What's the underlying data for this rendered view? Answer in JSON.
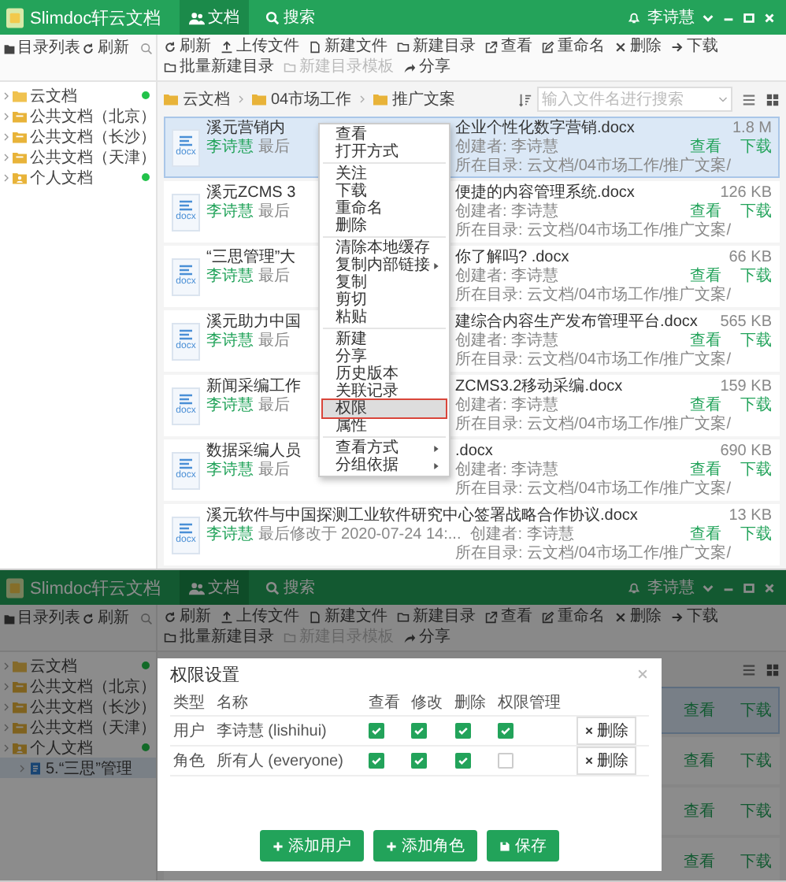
{
  "top": {
    "header": {
      "app_name": "Slimdoc轩云文档",
      "tabs": [
        {
          "label": "文档",
          "selected": true
        },
        {
          "label": "搜索",
          "selected": false
        }
      ],
      "user": "李诗慧"
    },
    "toolbar_left": {
      "title": "目录列表",
      "refresh": "刷新"
    },
    "toolbar": [
      {
        "label": "刷新",
        "disabled": false
      },
      {
        "label": "上传文件",
        "disabled": false
      },
      {
        "label": "新建文件",
        "disabled": false
      },
      {
        "label": "新建目录",
        "disabled": false
      },
      {
        "label": "查看",
        "disabled": false
      },
      {
        "label": "重命名",
        "disabled": false
      },
      {
        "label": "删除",
        "disabled": false
      },
      {
        "label": "下载",
        "disabled": false
      },
      {
        "label": "批量新建目录",
        "disabled": false
      },
      {
        "label": "新建目录模板",
        "disabled": true
      },
      {
        "label": "分享",
        "disabled": false
      }
    ],
    "sidebar": [
      {
        "label": "云文档",
        "kind": "cloud",
        "selected": false
      },
      {
        "label": "公共文档（北京）",
        "kind": "folder",
        "selected": false
      },
      {
        "label": "公共文档（长沙）",
        "kind": "folder",
        "selected": false
      },
      {
        "label": "公共文档（天津）",
        "kind": "folder",
        "selected": false
      },
      {
        "label": "个人文档",
        "kind": "personal",
        "selected": false
      }
    ],
    "breadcrumb": [
      "云文档",
      "04市场工作",
      "推广文案"
    ],
    "search": {
      "placeholder": "输入文件名进行搜索"
    },
    "files": [
      {
        "ext": "docx",
        "name": "溪元营销内",
        "name_tail": "企业个性化数字营销.docx",
        "author": "李诗慧",
        "modified": "最后",
        "creator": "创建者: 李诗慧",
        "folder": "所在目录: 云文档/04市场工作/推广文案/",
        "size": "1.8 M",
        "view": "查看",
        "download": "下载",
        "selected": true
      },
      {
        "ext": "docx",
        "name": "溪元ZCMS 3",
        "name_tail": "便捷的内容管理系统.docx",
        "author": "李诗慧",
        "modified": "最后",
        "creator": "创建者: 李诗慧",
        "folder": "所在目录: 云文档/04市场工作/推广文案/",
        "size": "126 KB",
        "view": "查看",
        "download": "下载",
        "selected": false
      },
      {
        "ext": "docx",
        "name": "“三思管理”大",
        "name_tail": "你了解吗? .docx",
        "author": "李诗慧",
        "modified": "最后",
        "creator": "创建者: 李诗慧",
        "folder": "所在目录: 云文档/04市场工作/推广文案/",
        "size": "66 KB",
        "view": "查看",
        "download": "下载",
        "selected": false
      },
      {
        "ext": "docx",
        "name": "溪元助力中国",
        "name_tail": "建综合内容生产发布管理平台.docx",
        "author": "李诗慧",
        "modified": "最后",
        "creator": "创建者: 李诗慧",
        "folder": "所在目录: 云文档/04市场工作/推广文案/",
        "size": "565 KB",
        "view": "查看",
        "download": "下载",
        "selected": false
      },
      {
        "ext": "docx",
        "name": "新闻采编工作",
        "name_tail": "ZCMS3.2移动采编.docx",
        "author": "李诗慧",
        "modified": "最后",
        "creator": "创建者: 李诗慧",
        "folder": "所在目录: 云文档/04市场工作/推广文案/",
        "size": "159 KB",
        "view": "查看",
        "download": "下载",
        "selected": false
      },
      {
        "ext": "docx",
        "name": "数据采编人员",
        "name_tail": ".docx",
        "author": "李诗慧",
        "modified": "最后",
        "creator": "创建者: 李诗慧",
        "folder": "所在目录: 云文档/04市场工作/推广文案/",
        "size": "690 KB",
        "view": "查看",
        "download": "下载",
        "selected": false
      },
      {
        "ext": "docx",
        "name": "溪元软件与中国探测工业软件研究中心签署战略合作协议.docx",
        "author": "李诗慧",
        "modified": "最后修改于 2020-07-24 14:...",
        "creator": "创建者: 李诗慧",
        "folder": "所在目录: 云文档/04市场工作/推广文案/",
        "size": "13 KB",
        "view": "查看",
        "download": "下载",
        "selected": false
      }
    ],
    "context_menu": [
      {
        "kind": "item",
        "label": "查看",
        "submenu": false,
        "selected": false
      },
      {
        "kind": "item",
        "label": "打开方式",
        "submenu": false,
        "selected": false
      },
      {
        "kind": "separator"
      },
      {
        "kind": "item",
        "label": "关注",
        "submenu": false,
        "selected": false
      },
      {
        "kind": "item",
        "label": "下载",
        "submenu": false,
        "selected": false
      },
      {
        "kind": "item",
        "label": "重命名",
        "submenu": false,
        "selected": false
      },
      {
        "kind": "item",
        "label": "删除",
        "submenu": false,
        "selected": false
      },
      {
        "kind": "separator"
      },
      {
        "kind": "item",
        "label": "清除本地缓存",
        "submenu": false,
        "selected": false
      },
      {
        "kind": "item",
        "label": "复制内部链接",
        "submenu": true,
        "selected": false
      },
      {
        "kind": "item",
        "label": "复制",
        "submenu": false,
        "selected": false
      },
      {
        "kind": "item",
        "label": "剪切",
        "submenu": false,
        "selected": false
      },
      {
        "kind": "item",
        "label": "粘贴",
        "submenu": false,
        "selected": false
      },
      {
        "kind": "separator"
      },
      {
        "kind": "item",
        "label": "新建",
        "submenu": false,
        "selected": false
      },
      {
        "kind": "item",
        "label": "分享",
        "submenu": false,
        "selected": false
      },
      {
        "kind": "item",
        "label": "历史版本",
        "submenu": false,
        "selected": false
      },
      {
        "kind": "item",
        "label": "关联记录",
        "submenu": false,
        "selected": false
      },
      {
        "kind": "item",
        "label": "权限",
        "submenu": false,
        "selected": true
      },
      {
        "kind": "item",
        "label": "属性",
        "submenu": false,
        "selected": false
      },
      {
        "kind": "separator"
      },
      {
        "kind": "item",
        "label": "查看方式",
        "submenu": true,
        "selected": false
      },
      {
        "kind": "item",
        "label": "分组依据",
        "submenu": true,
        "selected": false
      }
    ]
  },
  "bottom": {
    "header": {
      "app_name": "Slimdoc轩云文档",
      "tabs": [
        {
          "label": "文档",
          "selected": true
        },
        {
          "label": "搜索",
          "selected": false
        }
      ],
      "user": "李诗慧"
    },
    "toolbar_left": {
      "title": "目录列表",
      "refresh": "刷新"
    },
    "toolbar": [
      {
        "label": "刷新",
        "disabled": false
      },
      {
        "label": "上传文件",
        "disabled": false
      },
      {
        "label": "新建文件",
        "disabled": false
      },
      {
        "label": "新建目录",
        "disabled": false
      },
      {
        "label": "查看",
        "disabled": false
      },
      {
        "label": "重命名",
        "disabled": false
      },
      {
        "label": "删除",
        "disabled": false
      },
      {
        "label": "下载",
        "disabled": false
      },
      {
        "label": "批量新建目录",
        "disabled": false
      },
      {
        "label": "新建目录模板",
        "disabled": true
      },
      {
        "label": "分享",
        "disabled": false
      }
    ],
    "sidebar": [
      {
        "label": "云文档",
        "kind": "cloud",
        "selected": false
      },
      {
        "label": "公共文档（北京）",
        "kind": "folder",
        "selected": false
      },
      {
        "label": "公共文档（长沙）",
        "kind": "folder",
        "selected": false
      },
      {
        "label": "公共文档（天津）",
        "kind": "folder",
        "selected": false
      },
      {
        "label": "个人文档",
        "kind": "personal",
        "selected": false,
        "children": [
          {
            "label": "5.“三思”管理",
            "kind": "doc",
            "selected": true
          }
        ]
      }
    ],
    "rows": [
      {
        "view": "查看",
        "download": "下载",
        "selected": true
      },
      {
        "view": "查看",
        "download": "下载",
        "selected": false
      },
      {
        "view": "查看",
        "download": "下载",
        "selected": false
      },
      {
        "view": "查看",
        "download": "下载",
        "selected": false
      }
    ],
    "dialog": {
      "title": "权限设置",
      "columns": [
        "类型",
        "名称",
        "查看",
        "修改",
        "删除",
        "权限管理"
      ],
      "rows": [
        {
          "type": "用户",
          "name": "李诗慧 (lishihui)",
          "view": true,
          "edit": true,
          "delete": true,
          "manage": true,
          "remove": "删除"
        },
        {
          "type": "角色",
          "name": "所有人 (everyone)",
          "view": true,
          "edit": true,
          "delete": true,
          "manage": false,
          "remove": "删除"
        }
      ],
      "buttons": [
        {
          "label": "添加用户",
          "kind": "add"
        },
        {
          "label": "添加角色",
          "kind": "add"
        },
        {
          "label": "保存",
          "kind": "save"
        }
      ]
    }
  }
}
